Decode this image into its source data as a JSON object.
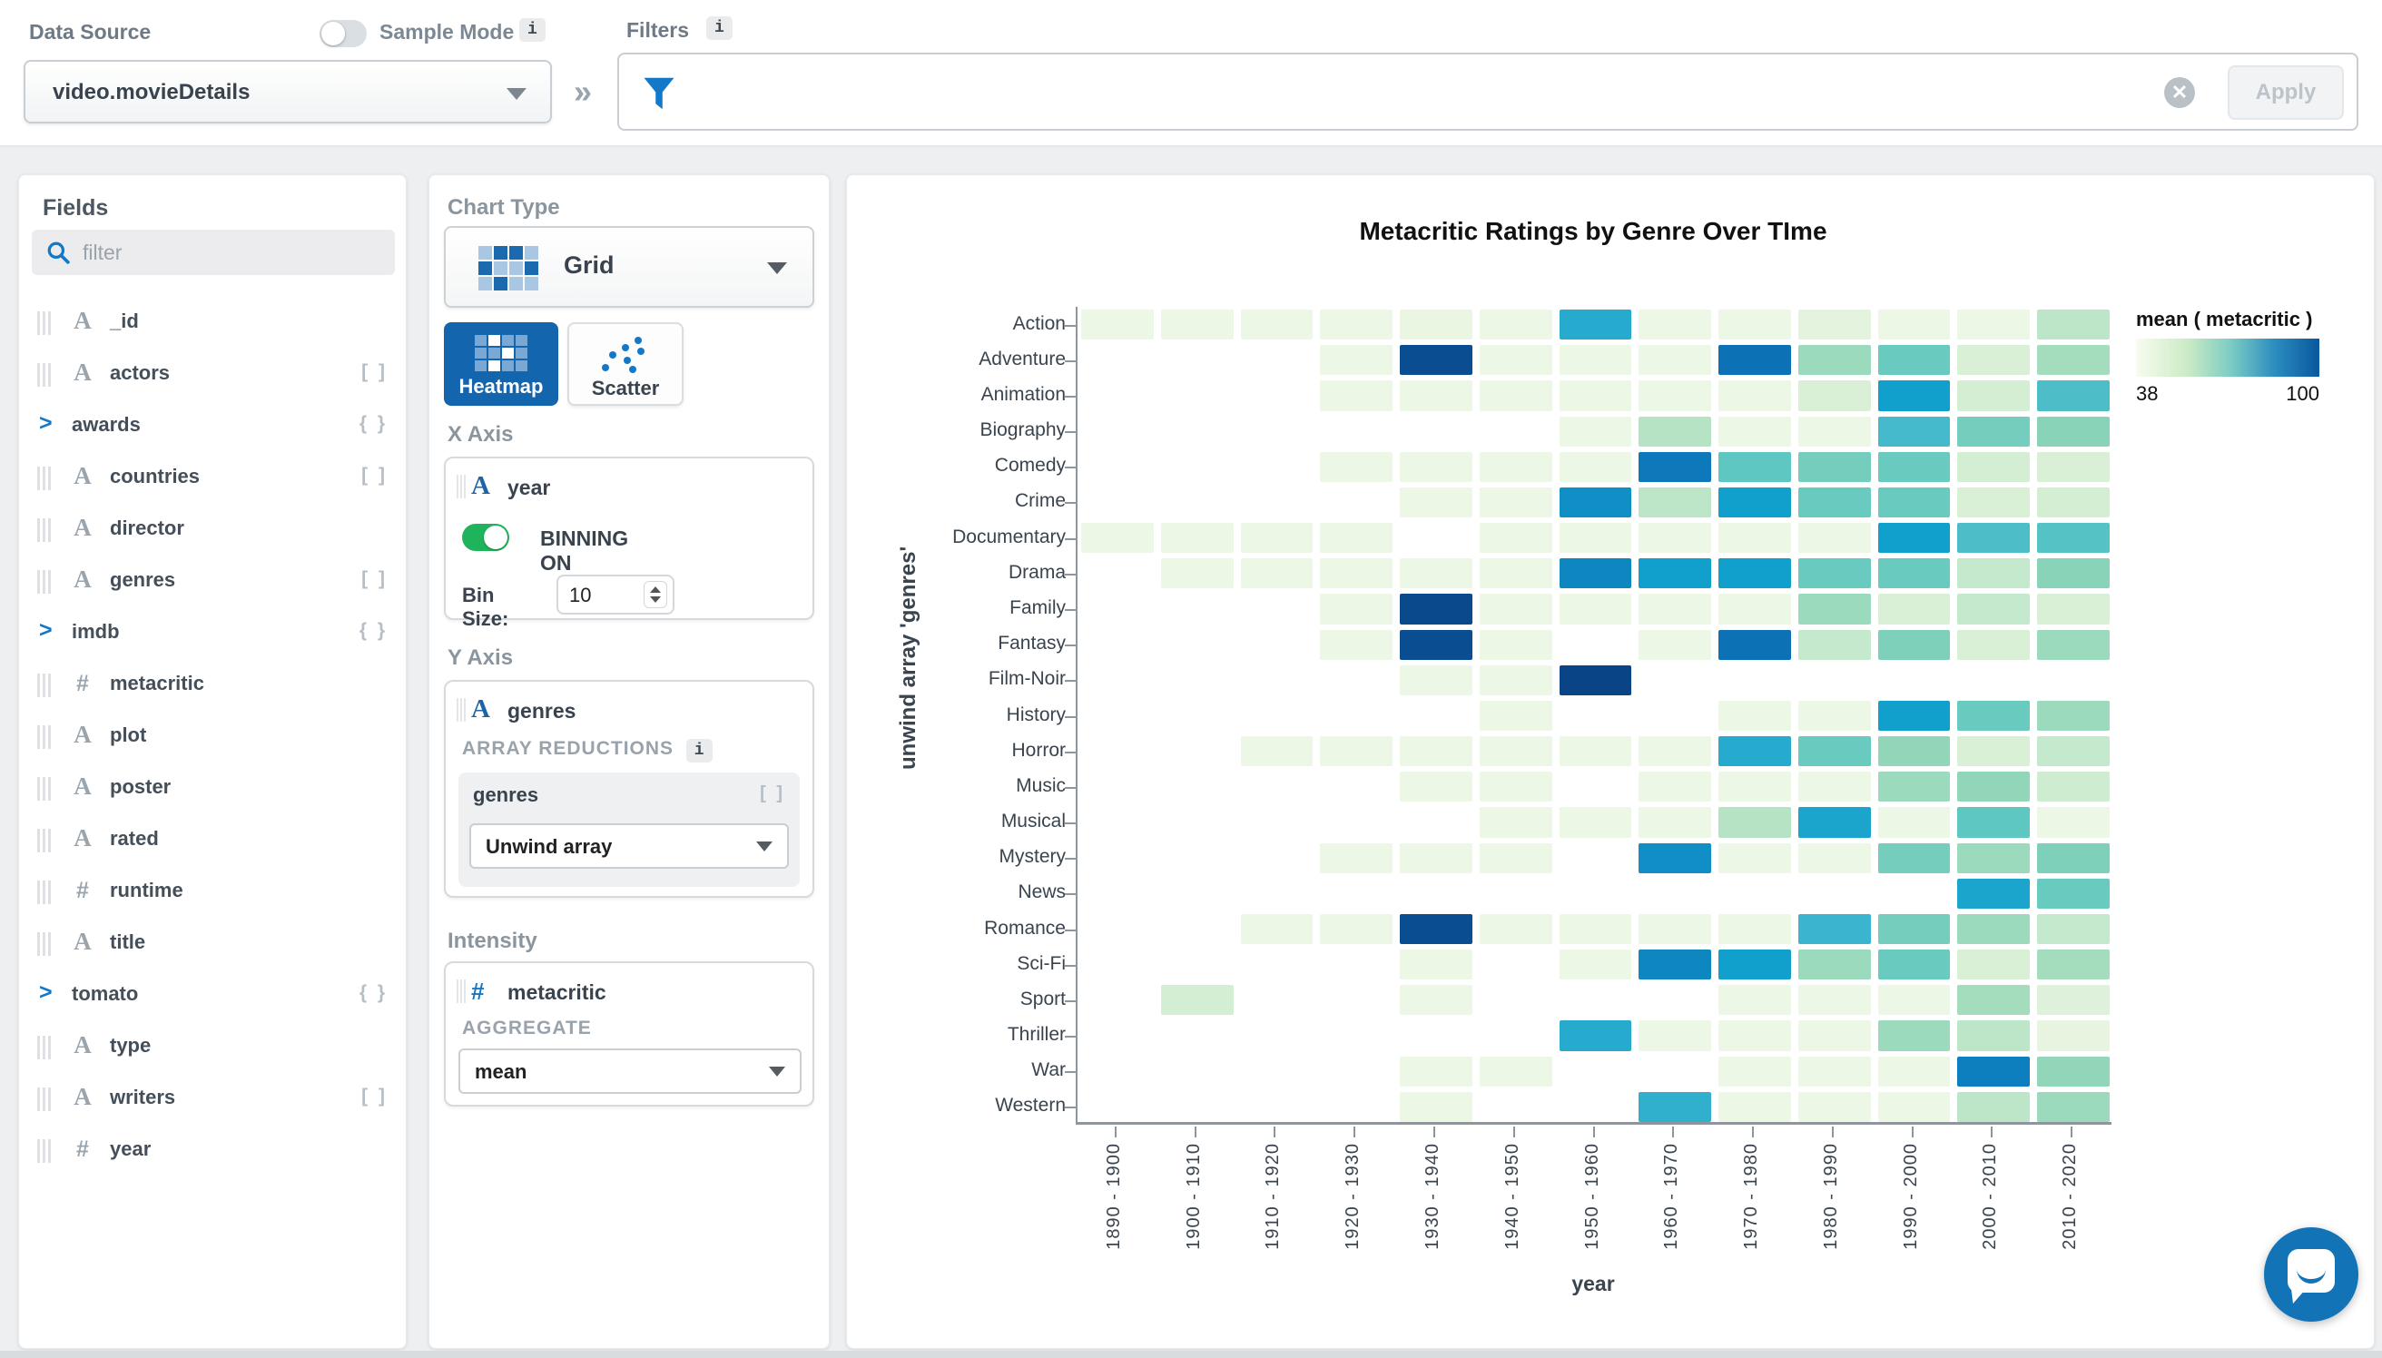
{
  "topbar": {
    "data_source_label": "Data Source",
    "sample_mode_label": "Sample Mode",
    "info_badge": "i",
    "data_source_value": "video.movieDetails",
    "chevrons": "»",
    "filters_label": "Filters",
    "filter_value": "",
    "filter_placeholder": "",
    "clear_glyph": "✕",
    "apply_label": "Apply"
  },
  "fields_panel": {
    "title": "Fields",
    "filter_placeholder": "filter",
    "fields": [
      {
        "name": "_id",
        "kind": "string",
        "badge": ""
      },
      {
        "name": "actors",
        "kind": "string",
        "badge": "[ ]"
      },
      {
        "name": "awards",
        "kind": "object",
        "badge": "{ }"
      },
      {
        "name": "countries",
        "kind": "string",
        "badge": "[ ]"
      },
      {
        "name": "director",
        "kind": "string",
        "badge": ""
      },
      {
        "name": "genres",
        "kind": "string",
        "badge": "[ ]"
      },
      {
        "name": "imdb",
        "kind": "object",
        "badge": "{ }"
      },
      {
        "name": "metacritic",
        "kind": "number",
        "badge": ""
      },
      {
        "name": "plot",
        "kind": "string",
        "badge": ""
      },
      {
        "name": "poster",
        "kind": "string",
        "badge": ""
      },
      {
        "name": "rated",
        "kind": "string",
        "badge": ""
      },
      {
        "name": "runtime",
        "kind": "number",
        "badge": ""
      },
      {
        "name": "title",
        "kind": "string",
        "badge": ""
      },
      {
        "name": "tomato",
        "kind": "object",
        "badge": "{ }"
      },
      {
        "name": "type",
        "kind": "string",
        "badge": ""
      },
      {
        "name": "writers",
        "kind": "string",
        "badge": "[ ]"
      },
      {
        "name": "year",
        "kind": "number",
        "badge": ""
      }
    ]
  },
  "encode_panel": {
    "chart_type_label": "Chart Type",
    "chart_type_value": "Grid",
    "heatmap_label": "Heatmap",
    "scatter_label": "Scatter",
    "x_axis": {
      "heading": "X Axis",
      "field": "year",
      "binning_label": "BINNING ON",
      "bin_size_label": "Bin Size:",
      "bin_size_value": "10"
    },
    "y_axis": {
      "heading": "Y Axis",
      "field": "genres",
      "reductions_label": "ARRAY REDUCTIONS",
      "info_badge": "i",
      "reduction_field": "genres",
      "reduction_badge": "[ ]",
      "reduction_value": "Unwind array"
    },
    "intensity": {
      "heading": "Intensity",
      "field": "metacritic",
      "aggregate_label": "AGGREGATE",
      "aggregate_value": "mean"
    }
  },
  "chart_data": {
    "type": "heatmap",
    "title": "Metacritic Ratings by Genre Over TIme",
    "xlabel": "year",
    "ylabel": "unwind array 'genres'",
    "legend": {
      "title": "mean ( metacritic )",
      "min": 38,
      "max": 100
    },
    "x_categories": [
      "1890 - 1900",
      "1900 - 1910",
      "1910 - 1920",
      "1920 - 1930",
      "1930 - 1940",
      "1940 - 1950",
      "1950 - 1960",
      "1960 - 1970",
      "1970 - 1980",
      "1980 - 1990",
      "1990 - 2000",
      "2000 - 2010",
      "2010 - 2020"
    ],
    "y_categories": [
      "Action",
      "Adventure",
      "Animation",
      "Biography",
      "Comedy",
      "Crime",
      "Documentary",
      "Drama",
      "Family",
      "Fantasy",
      "Film-Noir",
      "History",
      "Horror",
      "Music",
      "Musical",
      "Mystery",
      "News",
      "Romance",
      "Sci-Fi",
      "Sport",
      "Thriller",
      "War",
      "Western"
    ],
    "values": [
      [
        57,
        57,
        57,
        57,
        58,
        57,
        82,
        57,
        57,
        60,
        57,
        57,
        66
      ],
      [
        null,
        null,
        null,
        57,
        97,
        57,
        57,
        57,
        90,
        70,
        75,
        62,
        69
      ],
      [
        null,
        null,
        null,
        57,
        57,
        57,
        57,
        57,
        57,
        62,
        84,
        63,
        78
      ],
      [
        null,
        null,
        null,
        null,
        null,
        null,
        57,
        67,
        57,
        57,
        79,
        74,
        72
      ],
      [
        null,
        null,
        null,
        57,
        57,
        57,
        57,
        89,
        76,
        74,
        75,
        63,
        62
      ],
      [
        null,
        null,
        null,
        null,
        57,
        57,
        86,
        66,
        84,
        75,
        75,
        62,
        63
      ],
      [
        57,
        57,
        57,
        57,
        null,
        57,
        57,
        57,
        57,
        57,
        84,
        78,
        77
      ],
      [
        null,
        57,
        57,
        57,
        57,
        57,
        87,
        84,
        84,
        75,
        75,
        65,
        72
      ],
      [
        null,
        null,
        null,
        57,
        98,
        57,
        57,
        57,
        57,
        70,
        62,
        65,
        62
      ],
      [
        null,
        null,
        null,
        57,
        97,
        57,
        null,
        57,
        90,
        65,
        73,
        62,
        70
      ],
      [
        null,
        null,
        null,
        null,
        57,
        57,
        99,
        null,
        null,
        null,
        null,
        null,
        null
      ],
      [
        null,
        null,
        null,
        null,
        null,
        57,
        null,
        null,
        57,
        57,
        84,
        75,
        70
      ],
      [
        null,
        null,
        57,
        57,
        57,
        57,
        57,
        57,
        82,
        75,
        71,
        62,
        65
      ],
      [
        null,
        null,
        null,
        null,
        57,
        57,
        null,
        57,
        57,
        57,
        70,
        71,
        64
      ],
      [
        null,
        null,
        null,
        null,
        null,
        57,
        57,
        57,
        67,
        83,
        57,
        76,
        57
      ],
      [
        null,
        null,
        null,
        57,
        57,
        57,
        null,
        86,
        57,
        57,
        74,
        70,
        73
      ],
      [
        null,
        null,
        null,
        null,
        null,
        null,
        null,
        null,
        null,
        null,
        null,
        83,
        75
      ],
      [
        null,
        null,
        57,
        57,
        97,
        57,
        57,
        57,
        57,
        80,
        74,
        70,
        65
      ],
      [
        null,
        null,
        null,
        null,
        57,
        null,
        57,
        87,
        84,
        70,
        75,
        62,
        69
      ],
      [
        null,
        63,
        null,
        null,
        57,
        null,
        null,
        null,
        57,
        57,
        57,
        69,
        61
      ],
      [
        null,
        null,
        null,
        null,
        null,
        null,
        82,
        57,
        57,
        57,
        70,
        66,
        59
      ],
      [
        null,
        null,
        null,
        null,
        57,
        57,
        null,
        null,
        57,
        57,
        57,
        88,
        71
      ],
      [
        null,
        null,
        null,
        null,
        57,
        null,
        null,
        81,
        57,
        57,
        57,
        66,
        70
      ]
    ],
    "color_stops": [
      [
        38,
        "#f7fcf0"
      ],
      [
        56,
        "#f0f8e7"
      ],
      [
        60,
        "#e4f3dd"
      ],
      [
        64,
        "#cdecd0"
      ],
      [
        68,
        "#ade0c0"
      ],
      [
        72,
        "#89d3b8"
      ],
      [
        76,
        "#5ec7c1"
      ],
      [
        80,
        "#3bb5cf"
      ],
      [
        84,
        "#119fcb"
      ],
      [
        88,
        "#0d7fbe"
      ],
      [
        92,
        "#0c64ac"
      ],
      [
        100,
        "#084081"
      ]
    ],
    "grid": false,
    "legend_position": "top-right"
  }
}
